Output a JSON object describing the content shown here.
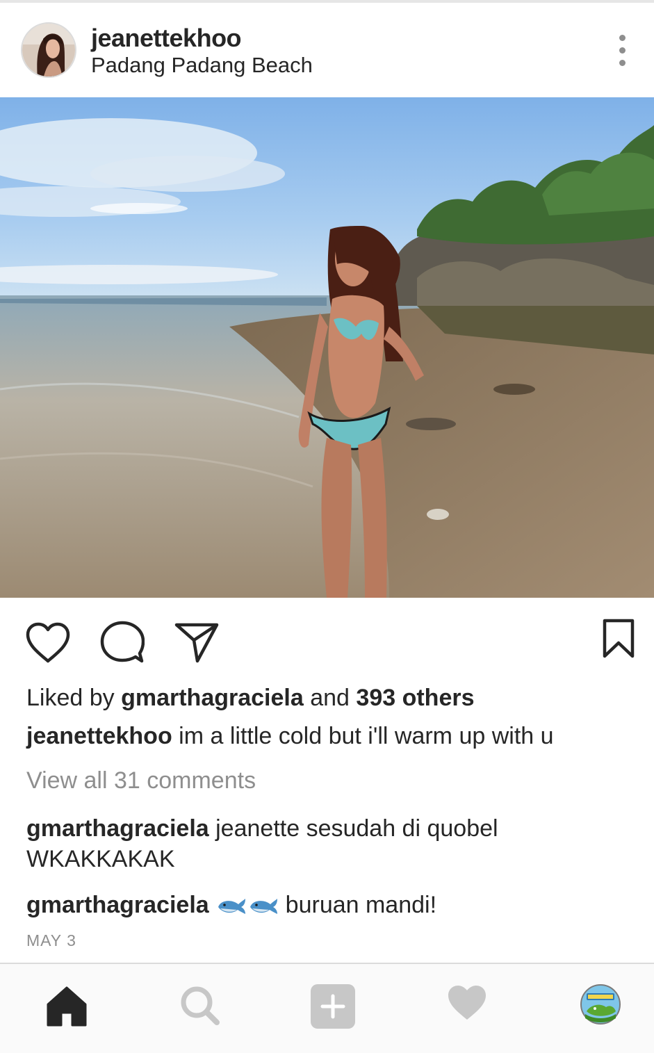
{
  "post": {
    "username": "jeanettekhoo",
    "location": "Padang Padang Beach",
    "likes": {
      "prefix": "Liked by",
      "liker": "gmarthagraciela",
      "conjunction": "and",
      "others": "393 others"
    },
    "caption": {
      "username": "jeanettekhoo",
      "text": "im a little cold but i'll warm up with u"
    },
    "view_all_comments": "View all 31 comments",
    "comments": [
      {
        "username": "gmarthagraciela",
        "text": "jeanette sesudah di quobel WKAKKAKAK"
      },
      {
        "username": "gmarthagraciela",
        "emoji": "whale-emoji x2",
        "text": "buruan mandi!"
      }
    ],
    "date": "MAY 3"
  },
  "icons": {
    "header": [
      "more-options-icon"
    ],
    "actions": [
      "heart-icon",
      "comment-icon",
      "share-icon",
      "bookmark-icon"
    ],
    "bottom_nav": [
      "home-icon",
      "search-icon",
      "add-post-icon",
      "activity-heart-icon",
      "profile-avatar"
    ]
  },
  "colors": {
    "text": "#262626",
    "secondary_text": "#8e8e8e",
    "nav_background": "#fafafa",
    "divider": "#dbdbdb",
    "inactive_icon": "#c7c7c7"
  }
}
